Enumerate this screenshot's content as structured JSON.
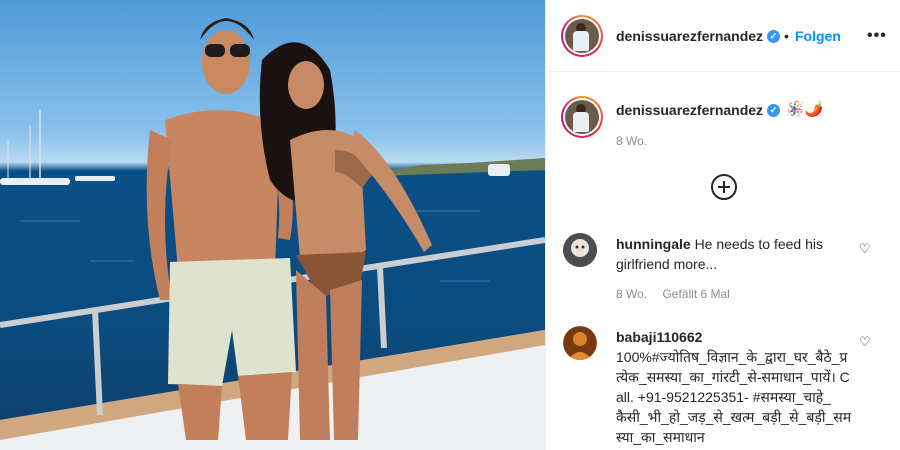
{
  "post": {
    "username": "denissuarezfernandez",
    "verified_badge": "✓",
    "dot": "•",
    "follow_label": "Folgen",
    "more_label": "•••"
  },
  "caption": {
    "username": "denissuarezfernandez",
    "emojis": "🪅🌶️",
    "time": "8 Wo."
  },
  "comments": [
    {
      "username": "hunningale",
      "text": "He needs to feed his girlfriend more...",
      "time": "8 Wo.",
      "likes": "Gefällt 6 Mal"
    },
    {
      "username": "babaji110662",
      "text": "100%#ज्योतिष_विज्ञान_के_द्वारा_घर_बैठे_प्रत्येक_समस्या_का_गांरटी_से-समाधान_पायें। Call. +91-9521225351- #समस्या_चाहे_कैसी_भी_हो_जड़_से_खत्म_बड़ी_से_बड़ी_समस्या_का_समाधान"
    }
  ],
  "icons": {
    "heart": "♡"
  }
}
